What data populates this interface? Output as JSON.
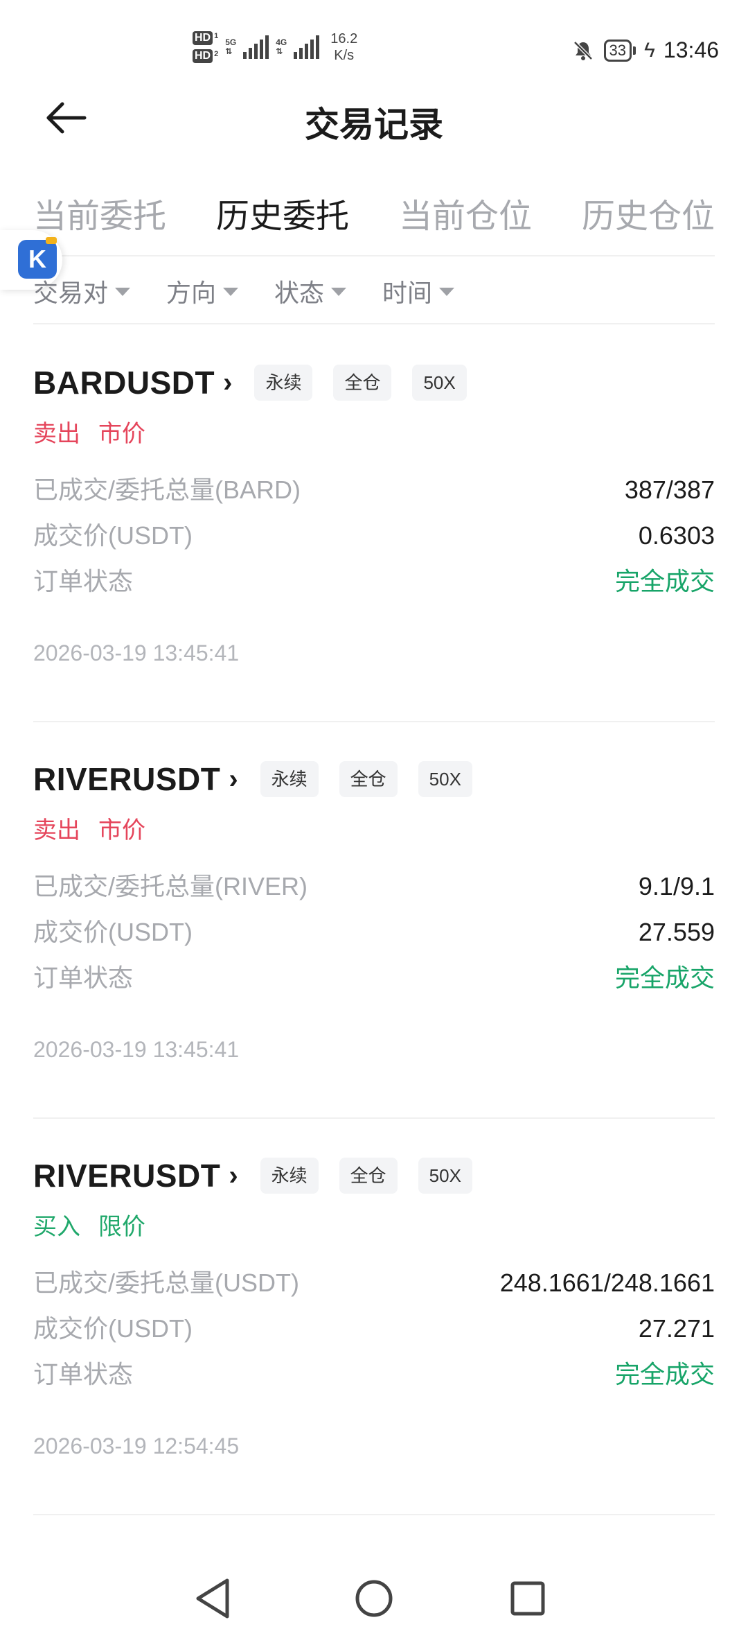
{
  "status_bar": {
    "hd1": "HD",
    "hd1_sub": "1",
    "hd2": "HD",
    "hd2_sub": "2",
    "net1": "5G",
    "net2": "4G",
    "speed_value": "16.2",
    "speed_unit": "K/s",
    "battery": "33",
    "time": "13:46"
  },
  "header": {
    "title": "交易记录"
  },
  "tabs": [
    {
      "label": "当前委托",
      "active": false
    },
    {
      "label": "历史委托",
      "active": true
    },
    {
      "label": "当前仓位",
      "active": false
    },
    {
      "label": "历史仓位",
      "active": false
    }
  ],
  "float_badge": {
    "letter": "K"
  },
  "filters": [
    {
      "label": "交易对"
    },
    {
      "label": "方向"
    },
    {
      "label": "状态"
    },
    {
      "label": "时间"
    }
  ],
  "orders": [
    {
      "pair": "BARDUSDT",
      "tags": [
        "永续",
        "全仓",
        "50X"
      ],
      "side": "卖出",
      "type": "市价",
      "filled_label": "已成交/委托总量(BARD)",
      "filled_value": "387/387",
      "price_label": "成交价(USDT)",
      "price_value": "0.6303",
      "status_label": "订单状态",
      "status_value": "完全成交",
      "time": "2026-03-19 13:45:41"
    },
    {
      "pair": "RIVERUSDT",
      "tags": [
        "永续",
        "全仓",
        "50X"
      ],
      "side": "卖出",
      "type": "市价",
      "filled_label": "已成交/委托总量(RIVER)",
      "filled_value": "9.1/9.1",
      "price_label": "成交价(USDT)",
      "price_value": "27.559",
      "status_label": "订单状态",
      "status_value": "完全成交",
      "time": "2026-03-19 13:45:41"
    },
    {
      "pair": "RIVERUSDT",
      "tags": [
        "永续",
        "全仓",
        "50X"
      ],
      "side": "买入",
      "type": "限价",
      "filled_label": "已成交/委托总量(USDT)",
      "filled_value": "248.1661/248.1661",
      "price_label": "成交价(USDT)",
      "price_value": "27.271",
      "status_label": "订单状态",
      "status_value": "完全成交",
      "time": "2026-03-19 12:54:45"
    }
  ],
  "colors": {
    "sell": "#e5455b",
    "buy": "#20a86b",
    "success": "#17a468",
    "muted": "#a7a9ae"
  }
}
